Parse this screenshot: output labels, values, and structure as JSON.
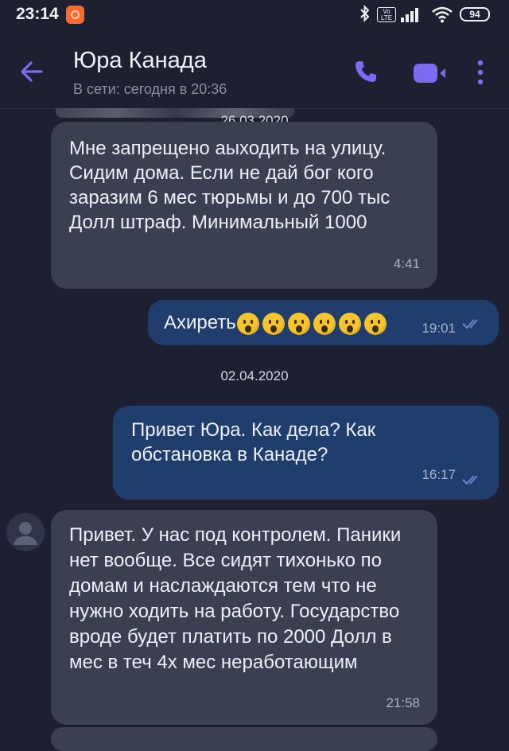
{
  "status_bar": {
    "time": "23:14",
    "battery": "94",
    "volte": "Vo LTE"
  },
  "header": {
    "contact_name": "Юра Канада",
    "status": "В сети: сегодня в 20:36"
  },
  "colors": {
    "accent": "#7b6bf0",
    "incoming_bubble": "#3a3f52",
    "outgoing_bubble": "#1f3d6d",
    "background": "#1c2030"
  },
  "messages": [
    {
      "type": "date",
      "text": "26.03.2020"
    },
    {
      "type": "incoming",
      "text": "Мне запрещено аыходить на улицу. Сидим дома. Если не дай бог кого заразим 6 мес тюрьмы и до 700 тыс Долл штраф. Минимальный 1000",
      "time": "4:41"
    },
    {
      "type": "outgoing",
      "text": "Ахиреть",
      "emoji_count": 6,
      "emoji": "hushed-face-emoji",
      "time": "19:01",
      "status": "read"
    },
    {
      "type": "date",
      "text": "02.04.2020"
    },
    {
      "type": "outgoing",
      "text": "Привет Юра. Как дела? Как обстановка в Канаде?",
      "time": "16:17",
      "status": "read"
    },
    {
      "type": "incoming",
      "text": "Привет. У нас под контролем. Паники нет вообще. Все сидят тихонько по домам и наслаждаются тем что не нужно ходить на работу. Государство вроде будет платить по 2000 Долл в мес в теч 4х мес неработающим",
      "time": "21:58"
    }
  ]
}
